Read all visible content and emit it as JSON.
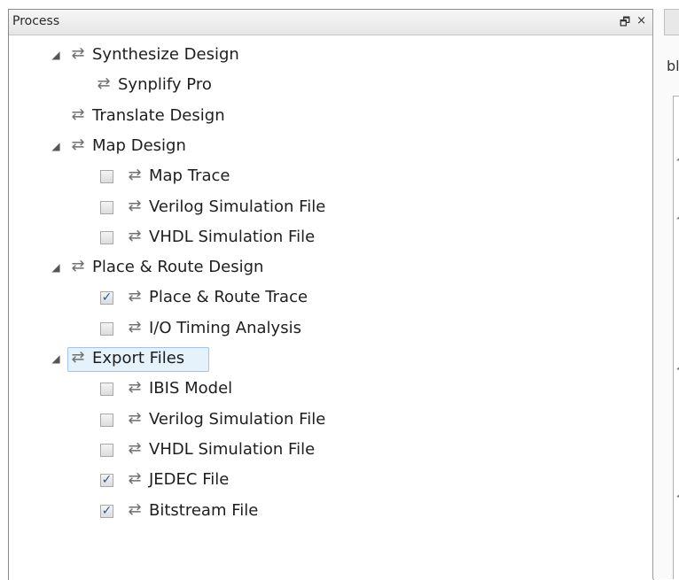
{
  "panel": {
    "title": "Process",
    "restore_glyph": "🗗",
    "close_glyph": "×"
  },
  "tree": [
    {
      "label": "Synthesize Design",
      "level": 0,
      "expander": "◢",
      "checkbox": null,
      "icon": "sync-arrows-icon"
    },
    {
      "label": "Synplify Pro",
      "level": 1,
      "expander": null,
      "checkbox": null,
      "icon": "sync-arrows-icon"
    },
    {
      "label": "Translate Design",
      "level": 0,
      "expander": null,
      "checkbox": null,
      "icon": "sync-arrows-icon"
    },
    {
      "label": "Map Design",
      "level": 0,
      "expander": "◢",
      "checkbox": null,
      "icon": "sync-arrows-icon"
    },
    {
      "label": "Map Trace",
      "level": 1,
      "expander": null,
      "checkbox": false,
      "icon": "sync-arrows-icon"
    },
    {
      "label": "Verilog Simulation File",
      "level": 1,
      "expander": null,
      "checkbox": false,
      "icon": "sync-arrows-icon"
    },
    {
      "label": "VHDL Simulation File",
      "level": 1,
      "expander": null,
      "checkbox": false,
      "icon": "sync-arrows-icon"
    },
    {
      "label": "Place & Route Design",
      "level": 0,
      "expander": "◢",
      "checkbox": null,
      "icon": "sync-arrows-icon"
    },
    {
      "label": "Place & Route Trace",
      "level": 1,
      "expander": null,
      "checkbox": true,
      "icon": "sync-arrows-icon"
    },
    {
      "label": "I/O Timing Analysis",
      "level": 1,
      "expander": null,
      "checkbox": false,
      "icon": "sync-arrows-icon"
    },
    {
      "label": "Export Files",
      "level": 0,
      "expander": "◢",
      "checkbox": null,
      "icon": "sync-arrows-icon",
      "selected": true
    },
    {
      "label": "IBIS Model",
      "level": 1,
      "expander": null,
      "checkbox": false,
      "icon": "sync-arrows-icon"
    },
    {
      "label": "Verilog Simulation File",
      "level": 1,
      "expander": null,
      "checkbox": false,
      "icon": "sync-arrows-icon"
    },
    {
      "label": "VHDL Simulation File",
      "level": 1,
      "expander": null,
      "checkbox": false,
      "icon": "sync-arrows-icon"
    },
    {
      "label": "JEDEC File",
      "level": 1,
      "expander": null,
      "checkbox": true,
      "icon": "sync-arrows-icon"
    },
    {
      "label": "Bitstream File",
      "level": 1,
      "expander": null,
      "checkbox": true,
      "icon": "sync-arrows-icon"
    }
  ],
  "right_pane": {
    "fragment": "bl",
    "selection_color": "#e5f1fb",
    "checkmark_color": "#2b57a5"
  }
}
